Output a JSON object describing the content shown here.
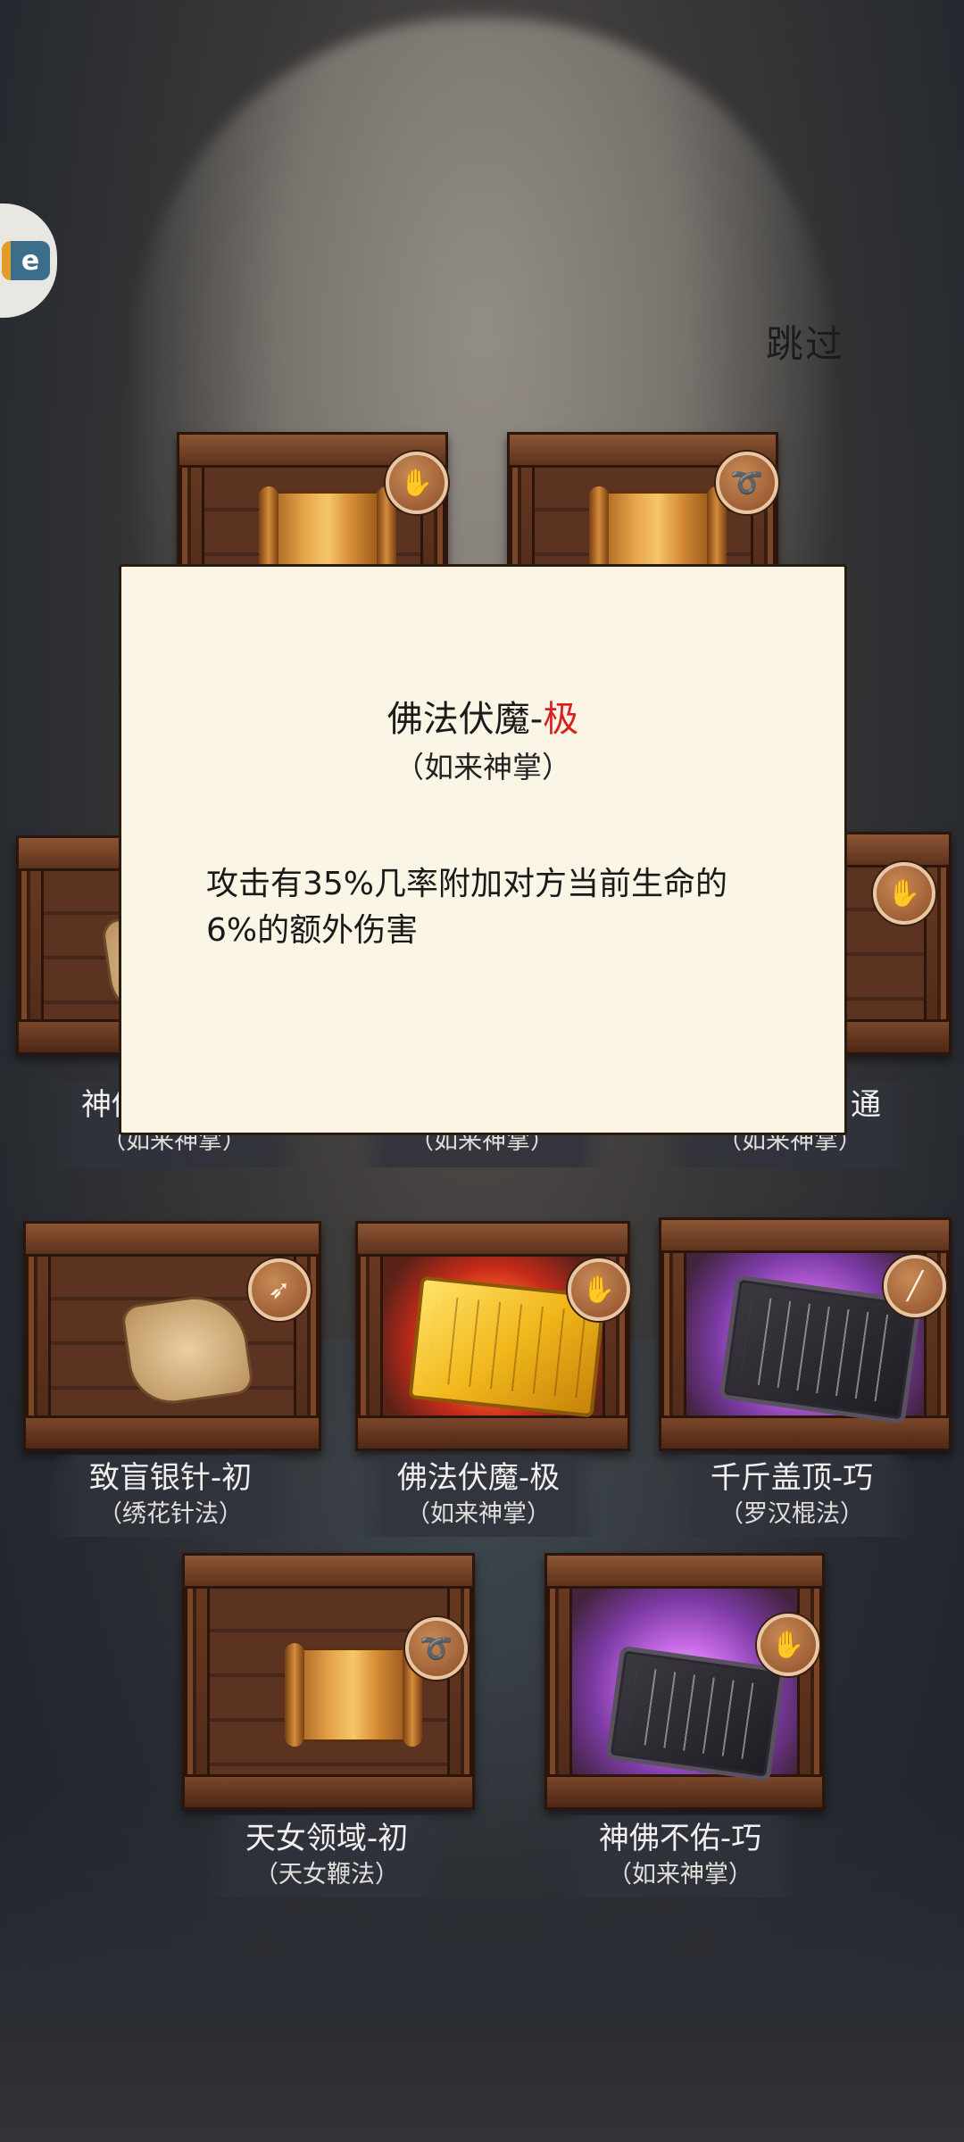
{
  "header": {
    "skip_label": "跳过"
  },
  "modal": {
    "skill_name": "佛法伏魔-",
    "grade": "极",
    "school": "（如来神掌）",
    "description": "攻击有35%几率附加对方当前生命的6%的额外伤害"
  },
  "obscured_labels": {
    "left_name": "神佛",
    "left_school": "（如来神掌）",
    "center_school": "（如来神掌）",
    "right_name": "通",
    "right_school": "（如来神掌）"
  },
  "rewards": [
    {
      "name": "致盲银针-初",
      "school": "（绣花针法）",
      "icon": "dart-icon",
      "item": "scroll-parchment"
    },
    {
      "name": "佛法伏魔-极",
      "school": "（如来神掌）",
      "icon": "palm-icon",
      "item": "golden-book"
    },
    {
      "name": "千斤盖顶-巧",
      "school": "（罗汉棍法）",
      "icon": "staff-icon",
      "item": "stone-tablet"
    },
    {
      "name": "天女领域-初",
      "school": "（天女鞭法）",
      "icon": "whip-icon",
      "item": "bamboo-scroll"
    },
    {
      "name": "神佛不佑-巧",
      "school": "（如来神掌）",
      "icon": "palm-icon",
      "item": "stone-tablet"
    }
  ],
  "colors": {
    "grade_red": "#d92020",
    "modal_bg": "#fbf5e6",
    "purple_glow": "#c86ae6",
    "red_glow": "#ff6a2a"
  }
}
